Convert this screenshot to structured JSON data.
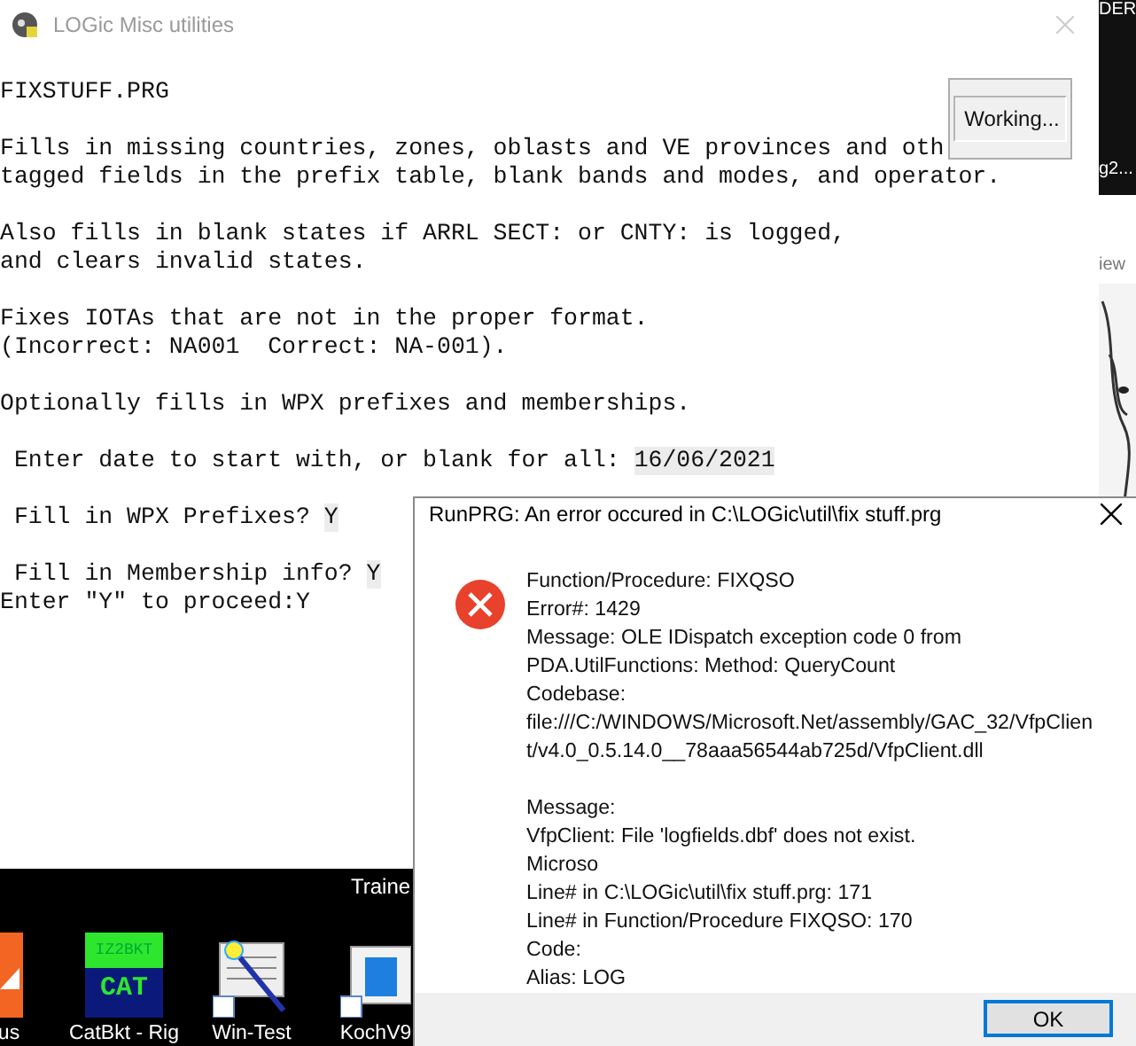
{
  "main_window": {
    "title": "LOGic Misc utilities",
    "console": [
      [
        {
          "kind": "text",
          "text": "FIXSTUFF.PRG"
        }
      ],
      [
        {
          "kind": "text",
          "text": "Fills in missing countries, zones, oblasts and VE provinces and oth"
        },
        {
          "kind": "text",
          "text": "tagged fields in the prefix table, blank bands and modes, and operator."
        }
      ],
      [
        {
          "kind": "text",
          "text": "Also fills in blank states if ARRL SECT: or CNTY: is logged,"
        },
        {
          "kind": "text",
          "text": "and clears invalid states."
        }
      ],
      [
        {
          "kind": "text",
          "text": "Fixes IOTAs that are not in the proper format."
        },
        {
          "kind": "text",
          "text": "(Incorrect: NA001  Correct: NA-001)."
        }
      ],
      [
        {
          "kind": "text",
          "text": "Optionally fills in WPX prefixes and memberships."
        }
      ],
      [
        {
          "kind": "prompt",
          "text": " Enter date to start with, or blank for all: ",
          "answer": "16/06/2021"
        }
      ],
      [
        {
          "kind": "prompt",
          "text": " Fill in WPX Prefixes? ",
          "answer": "Y"
        }
      ],
      [
        {
          "kind": "prompt",
          "text": " Fill in Membership info? ",
          "answer": "Y"
        },
        {
          "kind": "text",
          "text": "Enter \"Y\" to proceed:Y"
        }
      ]
    ],
    "working_button": "Working..."
  },
  "desktop": {
    "edge_labels": [
      "DER",
      "g2...",
      "iew"
    ],
    "caption": "Traine",
    "icons": [
      {
        "kind": "orange",
        "label": "us"
      },
      {
        "kind": "cat",
        "label": "CatBkt - Rig",
        "icon_text": [
          "IZ2BKT",
          "CAT"
        ]
      },
      {
        "kind": "wand",
        "label": "Win-Test"
      },
      {
        "kind": "window",
        "label": "KochV9"
      }
    ]
  },
  "error_dialog": {
    "title": "RunPRG: An error occured in C:\\LOGic\\util\\fix stuff.prg",
    "paragraphs": [
      [
        "Function/Procedure: FIXQSO",
        "Error#: 1429",
        "Message: OLE IDispatch exception code 0 from",
        "PDA.UtilFunctions: Method: QueryCount",
        "Codebase:",
        "file:///C:/WINDOWS/Microsoft.Net/assembly/GAC_32/VfpClien",
        "t/v4.0_0.5.14.0__78aaa56544ab725d/VfpClient.dll"
      ],
      [
        "Message:",
        "VfpClient: File 'logfields.dbf' does not exist.",
        "Microso",
        "Line# in C:\\LOGic\\util\\fix stuff.prg: 171",
        "Line# in Function/Procedure FIXQSO: 170",
        "Code:",
        "Alias: LOG"
      ]
    ],
    "ok_button": "OK"
  }
}
